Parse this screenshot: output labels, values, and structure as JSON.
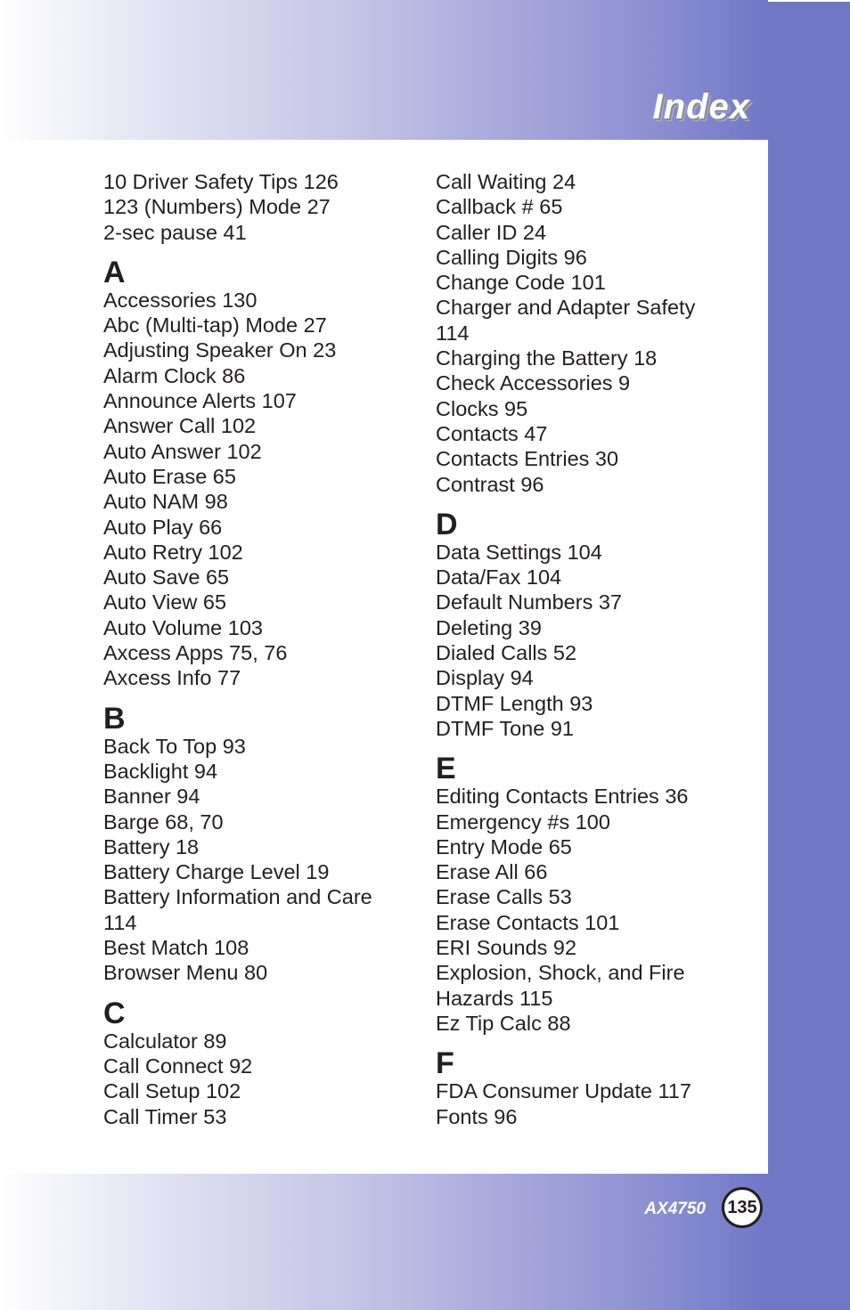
{
  "header": {
    "title": "Index"
  },
  "footer": {
    "model": "AX4750",
    "page_number": "135"
  },
  "colors": {
    "accent": "#7077c6",
    "text": "#231f20",
    "panel": "#ffffff"
  },
  "left_column": {
    "intro": [
      "10 Driver Safety Tips 126",
      "123 (Numbers) Mode 27",
      "2-sec pause 41"
    ],
    "sections": [
      {
        "letter": "A",
        "entries": [
          "Accessories 130",
          "Abc (Multi-tap) Mode 27",
          "Adjusting Speaker On 23",
          "Alarm Clock 86",
          "Announce Alerts 107",
          "Answer Call 102",
          "Auto Answer 102",
          "Auto Erase 65",
          "Auto NAM 98",
          "Auto Play 66",
          "Auto Retry 102",
          "Auto Save 65",
          "Auto View 65",
          "Auto Volume 103",
          "Axcess Apps 75, 76",
          "Axcess Info 77"
        ]
      },
      {
        "letter": "B",
        "entries": [
          "Back To Top 93",
          "Backlight 94",
          "Banner 94",
          "Barge 68, 70",
          "Battery 18",
          "Battery Charge Level 19",
          "Battery Information and Care",
          "114",
          "Best Match 108",
          "Browser Menu 80"
        ]
      },
      {
        "letter": "C",
        "entries": [
          "Calculator 89",
          "Call Connect 92",
          "Call Setup 102",
          "Call Timer 53"
        ]
      }
    ]
  },
  "right_column": {
    "intro": [
      "Call Waiting 24",
      "Callback # 65",
      "Caller ID 24",
      "Calling Digits 96",
      "Change Code 101",
      "Charger and Adapter Safety",
      "114",
      "Charging the Battery 18",
      "Check Accessories 9",
      "Clocks 95",
      "Contacts 47",
      "Contacts Entries 30",
      "Contrast 96"
    ],
    "sections": [
      {
        "letter": "D",
        "entries": [
          "Data Settings 104",
          "Data/Fax 104",
          "Default Numbers 37",
          "Deleting 39",
          "Dialed Calls 52",
          "Display 94",
          "DTMF Length 93",
          "DTMF Tone 91"
        ]
      },
      {
        "letter": "E",
        "entries": [
          "Editing Contacts Entries 36",
          "Emergency #s 100",
          "Entry Mode 65",
          "Erase All 66",
          "Erase Calls 53",
          "Erase Contacts 101",
          "ERI Sounds 92",
          "Explosion, Shock, and Fire",
          "Hazards 115",
          "Ez Tip Calc 88"
        ]
      },
      {
        "letter": "F",
        "entries": [
          "FDA Consumer Update 117",
          "Fonts 96"
        ]
      }
    ]
  }
}
